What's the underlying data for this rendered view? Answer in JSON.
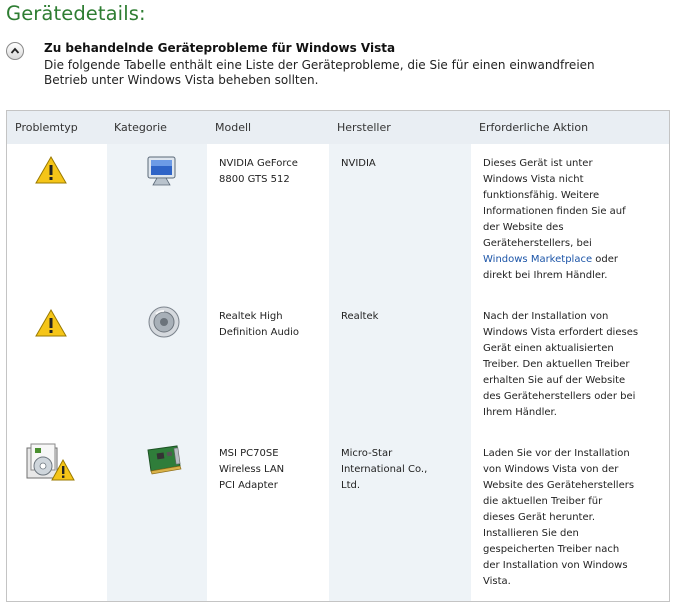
{
  "page": {
    "title": "Gerätedetails:"
  },
  "section": {
    "title": "Zu behandelnde Geräteprobleme für Windows Vista",
    "desc_line1": "Die folgende Tabelle enthält eine Liste der Geräteprobleme, die Sie für einen einwandfreien",
    "desc_line2": "Betrieb unter Windows Vista beheben sollten."
  },
  "table": {
    "headers": [
      "Problemtyp",
      "Kategorie",
      "Modell",
      "Hersteller",
      "Erforderliche Aktion"
    ],
    "rows": [
      {
        "problem_icon": "warning-icon",
        "category_icon": "monitor-icon",
        "model": [
          "NVIDIA GeForce",
          "8800 GTS 512"
        ],
        "vendor": [
          "NVIDIA"
        ],
        "action": [
          "Dieses Gerät ist unter",
          "Windows Vista nicht",
          "funktionsfähig. Weitere",
          "Informationen finden Sie auf",
          "der Website des",
          "Geräteherstellers, bei"
        ],
        "action_link": "Windows Marketplace",
        "action_after_link": " oder",
        "action_tail": "direkt bei Ihrem Händler."
      },
      {
        "problem_icon": "warning-icon",
        "category_icon": "speaker-icon",
        "model": [
          "Realtek High",
          "Definition Audio"
        ],
        "vendor": [
          "Realtek"
        ],
        "action": [
          "Nach der Installation von",
          "Windows Vista erfordert dieses",
          "Gerät einen aktualisierten",
          "Treiber. Den aktuellen Treiber",
          "erhalten Sie auf der Website",
          "des Geräteherstellers oder bei",
          "Ihrem Händler."
        ]
      },
      {
        "problem_icon": "install-warning-icon",
        "category_icon": "network-card-icon",
        "model": [
          "MSI PC70SE",
          "Wireless LAN",
          "PCI Adapter"
        ],
        "vendor": [
          "Micro-Star",
          "International Co.,",
          "Ltd."
        ],
        "action": [
          "Laden Sie vor der Installation",
          "von Windows Vista von der",
          "Website des Geräteherstellers",
          "die aktuellen Treiber für",
          "dieses Gerät herunter.",
          "Installieren Sie den",
          "gespeicherten Treiber nach",
          "der Installation von Windows",
          "Vista."
        ]
      }
    ]
  },
  "colors": {
    "title_green": "#2e7d32",
    "header_bg": "#e9eef3",
    "shaded_col": "#eef3f7",
    "link": "#1c55a8"
  }
}
